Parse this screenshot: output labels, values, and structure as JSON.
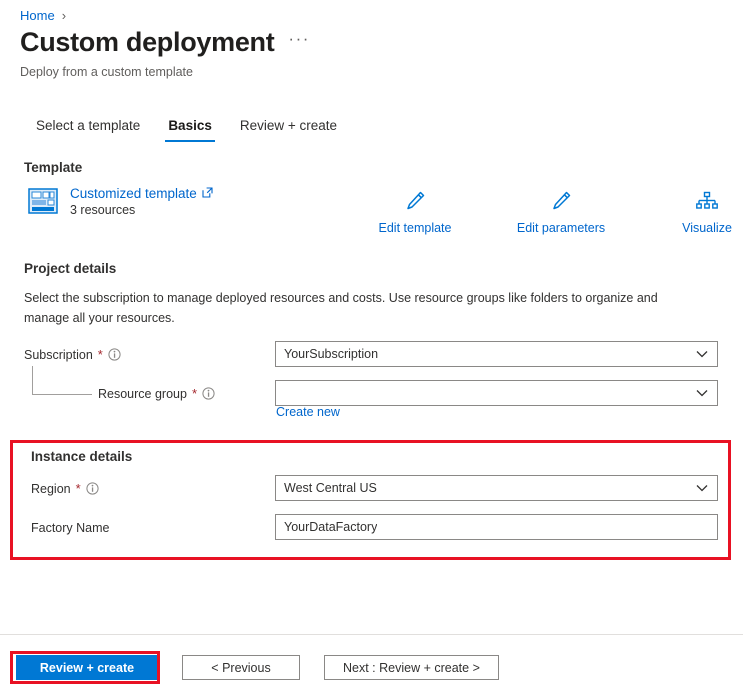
{
  "breadcrumb": {
    "home_label": "Home",
    "separator": "›"
  },
  "header": {
    "title": "Custom deployment",
    "subtitle": "Deploy from a custom template",
    "more_menu": "···"
  },
  "tabs": [
    {
      "label": "Select a template",
      "active": false
    },
    {
      "label": "Basics",
      "active": true
    },
    {
      "label": "Review + create",
      "active": false
    }
  ],
  "template_section": {
    "heading": "Template",
    "link_label": "Customized template",
    "external_icon": "external-link-icon",
    "resource_count": "3 resources",
    "actions": [
      {
        "label": "Edit template",
        "icon": "pencil-icon"
      },
      {
        "label": "Edit parameters",
        "icon": "pencil-icon"
      },
      {
        "label": "Visualize",
        "icon": "hierarchy-icon"
      }
    ]
  },
  "project_details": {
    "heading": "Project details",
    "description": "Select the subscription to manage deployed resources and costs. Use resource groups like folders to organize and manage all your resources.",
    "fields": {
      "subscription": {
        "label": "Subscription",
        "required": "*",
        "value": "YourSubscription",
        "type": "dropdown"
      },
      "resource_group": {
        "label": "Resource group",
        "required": "*",
        "value": "",
        "type": "dropdown",
        "create_new_label": "Create new"
      }
    }
  },
  "instance_details": {
    "heading": "Instance details",
    "fields": {
      "region": {
        "label": "Region",
        "required": "*",
        "value": "West Central US",
        "type": "dropdown"
      },
      "factory_name": {
        "label": "Factory Name",
        "required": "",
        "value": "YourDataFactory",
        "type": "text"
      }
    }
  },
  "footer": {
    "review_create_label": "Review + create",
    "previous_label": "< Previous",
    "next_label": "Next : Review + create >"
  },
  "colors": {
    "accent": "#0078d4",
    "link": "#0066cc",
    "highlight": "#e81123",
    "required": "#a4262c"
  }
}
